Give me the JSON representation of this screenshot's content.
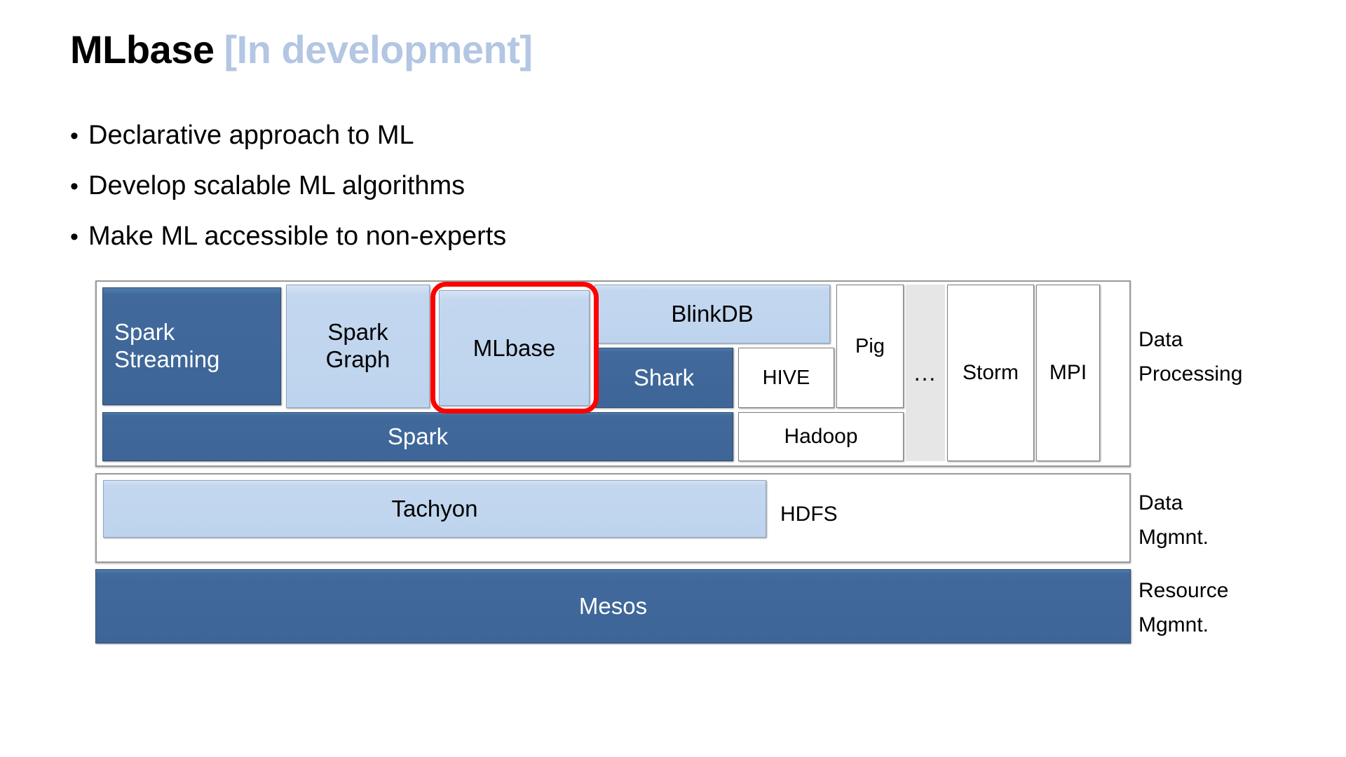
{
  "slide": {
    "title_main": "MLbase",
    "title_sub": "[In development]",
    "title_sub_color": "#b3c6e3",
    "bullets": [
      "Declarative approach to ML",
      "Develop scalable ML algorithms",
      "Make ML accessible to non-experts"
    ],
    "bullet_marker": "•"
  },
  "colors": {
    "dark_blue": "#3d6597",
    "light_blue": "#bed4ee",
    "white_box": "#ffffff",
    "gray_box": "#e6e6e6",
    "highlight_red": "#fe0000"
  },
  "diagram": {
    "tiers": [
      {
        "id": "data-processing",
        "label_line1": "Data",
        "label_line2": "Processing",
        "blocks": [
          {
            "id": "spark-streaming",
            "label": "Spark\nStreaming",
            "style": "dark",
            "align": "left"
          },
          {
            "id": "spark-graph",
            "label": "Spark\nGraph",
            "style": "light",
            "align": "center"
          },
          {
            "id": "mlbase",
            "label": "MLbase",
            "style": "light",
            "align": "center",
            "highlighted": true
          },
          {
            "id": "blinkdb",
            "label": "BlinkDB",
            "style": "light",
            "align": "center"
          },
          {
            "id": "shark",
            "label": "Shark",
            "style": "dark",
            "align": "center"
          },
          {
            "id": "hive",
            "label": "HIVE",
            "style": "white",
            "align": "center"
          },
          {
            "id": "pig",
            "label": "Pig",
            "style": "white",
            "align": "center"
          },
          {
            "id": "ellipsis",
            "label": "…",
            "style": "gray",
            "align": "center"
          },
          {
            "id": "storm",
            "label": "Storm",
            "style": "white",
            "align": "center"
          },
          {
            "id": "mpi",
            "label": "MPI",
            "style": "white",
            "align": "center"
          },
          {
            "id": "spark",
            "label": "Spark",
            "style": "dark",
            "align": "center"
          },
          {
            "id": "hadoop",
            "label": "Hadoop",
            "style": "white",
            "align": "center"
          }
        ]
      },
      {
        "id": "data-mgmt",
        "label_line1": "Data",
        "label_line2": "Mgmnt.",
        "blocks": [
          {
            "id": "tachyon",
            "label": "Tachyon",
            "style": "light",
            "align": "center"
          },
          {
            "id": "hdfs",
            "label": "HDFS",
            "style": "white",
            "align": "center"
          }
        ]
      },
      {
        "id": "resource-mgmt",
        "label_line1": "Resource",
        "label_line2": "Mgmnt.",
        "blocks": [
          {
            "id": "mesos",
            "label": "Mesos",
            "style": "dark",
            "align": "center"
          }
        ]
      }
    ]
  },
  "labels": {
    "spark_streaming_l1": "Spark",
    "spark_streaming_l2": "Streaming",
    "spark_graph_l1": "Spark",
    "spark_graph_l2": "Graph",
    "mlbase": "MLbase",
    "blinkdb": "BlinkDB",
    "shark": "Shark",
    "hive": "HIVE",
    "pig": "Pig",
    "ellipsis": "…",
    "storm": "Storm",
    "mpi": "MPI",
    "spark": "Spark",
    "hadoop": "Hadoop",
    "tachyon": "Tachyon",
    "hdfs": "HDFS",
    "mesos": "Mesos",
    "tier1_l1": "Data",
    "tier1_l2": "Processing",
    "tier2_l1": "Data",
    "tier2_l2": "Mgmnt.",
    "tier3_l1": "Resource",
    "tier3_l2": "Mgmnt."
  }
}
